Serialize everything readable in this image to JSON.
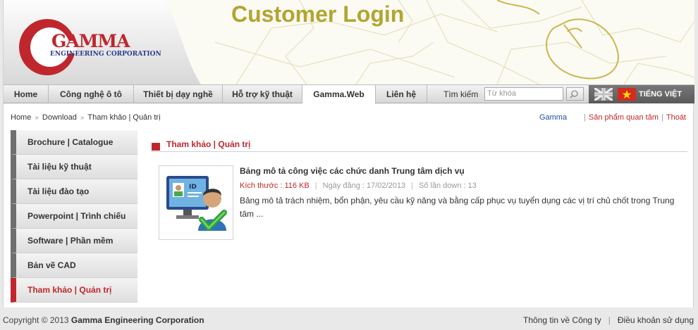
{
  "header": {
    "title": "Customer Login",
    "logo_word": "GAMMA",
    "logo_sub": "ENGINEERING CORPORATION",
    "brand_red": "#c0272d",
    "brand_blue": "#2b3a8f",
    "title_color": "#b3a532"
  },
  "nav": {
    "items": [
      "Home",
      "Công nghệ ô tô",
      "Thiết bị dạy nghề",
      "Hỗ trợ kỹ thuật",
      "Gamma.Web",
      "Liên hệ"
    ],
    "active": "Gamma.Web",
    "search_label": "Tìm kiếm",
    "search_placeholder": "Từ khóa",
    "language": "TIẾNG VIỆT"
  },
  "breadcrumb": [
    "Home",
    "Download",
    "Tham khảo | Quản trị"
  ],
  "top_links": {
    "gamma": "Gamma",
    "interest": "Sản phẩm quan tâm",
    "logout": "Thoát"
  },
  "sidebar": {
    "items": [
      "Brochure | Catalogue",
      "Tài liệu kỹ thuật",
      "Tài liệu đào tạo",
      "Powerpoint | Trình chiếu",
      "Software | Phần mềm",
      "Bản vẽ CAD",
      "Tham khảo | Quản trị"
    ],
    "active": "Tham khảo | Quản trị"
  },
  "main": {
    "section_title": "Tham khảo | Quản trị",
    "item": {
      "title": "Bảng mô tả công việc các chức danh Trung tâm dịch vụ",
      "size": "Kích thước : 116 KB",
      "date": "Ngày đăng : 17/02/2013",
      "downloads": "Số lần down : 13",
      "description": "Bảng mô tả trách nhiệm, bổn phận, yêu cầu kỹ năng và bằng cấp phục vụ tuyển dụng các vị trí chủ chốt trong Trung tâm ...",
      "thumb_icon": "id-card-user-check-icon"
    }
  },
  "footer": {
    "copyright_prefix": "Copyright © 2013",
    "company": "Gamma Engineering Corporation",
    "links": [
      "Thông tin về Công ty",
      "Điều khoản sử dụng"
    ]
  }
}
